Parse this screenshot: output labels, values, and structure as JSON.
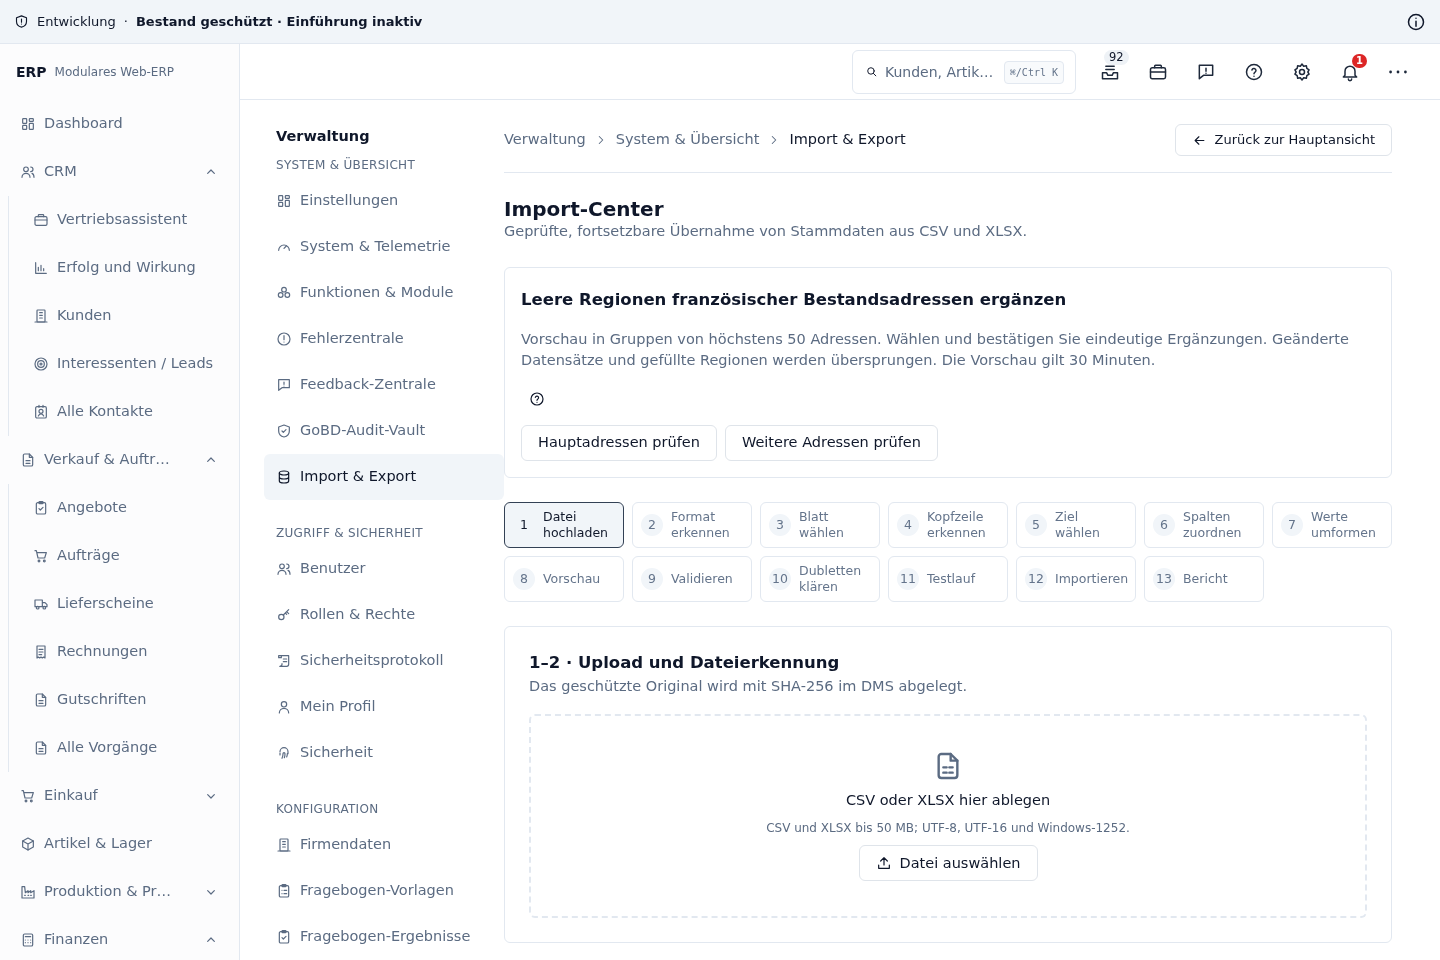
{
  "banner": {
    "environment": "Entwicklung",
    "separator": "·",
    "status": "Bestand geschützt · Einführung inaktiv"
  },
  "brand": {
    "name": "ERP",
    "subtitle": "Modulares Web-ERP"
  },
  "sidebar": {
    "items": [
      {
        "kind": "link",
        "label": "Dashboard"
      },
      {
        "kind": "group",
        "label": "CRM",
        "expanded": true,
        "children": [
          {
            "label": "Vertriebsassistent"
          },
          {
            "label": "Erfolg und Wirkung"
          },
          {
            "label": "Kunden"
          },
          {
            "label": "Interessenten / Leads"
          },
          {
            "label": "Alle Kontakte"
          }
        ]
      },
      {
        "kind": "group",
        "label": "Verkauf & Auftr…",
        "expanded": true,
        "children": [
          {
            "label": "Angebote"
          },
          {
            "label": "Aufträge"
          },
          {
            "label": "Lieferscheine"
          },
          {
            "label": "Rechnungen"
          },
          {
            "label": "Gutschriften"
          },
          {
            "label": "Alle Vorgänge"
          }
        ]
      },
      {
        "kind": "group",
        "label": "Einkauf",
        "expanded": false
      },
      {
        "kind": "link",
        "label": "Artikel & Lager"
      },
      {
        "kind": "group",
        "label": "Produktion & Pr…",
        "expanded": false
      },
      {
        "kind": "group",
        "label": "Finanzen",
        "expanded": true
      }
    ]
  },
  "header": {
    "search": {
      "placeholder": "Kunden, Artik…",
      "shortcut": "⌘/Ctrl K"
    },
    "inbox_count": "92",
    "notification_count": "1"
  },
  "subnav": {
    "title": "Verwaltung",
    "sections": [
      {
        "heading": "SYSTEM & ÜBERSICHT",
        "items": [
          {
            "label": "Einstellungen",
            "selected": false
          },
          {
            "label": "System & Telemetrie",
            "selected": false
          },
          {
            "label": "Funktionen & Module",
            "selected": false
          },
          {
            "label": "Fehlerzentrale",
            "selected": false
          },
          {
            "label": "Feedback-Zentrale",
            "selected": false
          },
          {
            "label": "GoBD-Audit-Vault",
            "selected": false
          },
          {
            "label": "Import & Export",
            "selected": true
          }
        ]
      },
      {
        "heading": "ZUGRIFF & SICHERHEIT",
        "items": [
          {
            "label": "Benutzer",
            "selected": false
          },
          {
            "label": "Rollen & Rechte",
            "selected": false
          },
          {
            "label": "Sicherheitsprotokoll",
            "selected": false
          },
          {
            "label": "Mein Profil",
            "selected": false
          },
          {
            "label": "Sicherheit",
            "selected": false
          }
        ]
      },
      {
        "heading": "KONFIGURATION",
        "items": [
          {
            "label": "Firmendaten",
            "selected": false
          },
          {
            "label": "Fragebogen-Vorlagen",
            "selected": false
          },
          {
            "label": "Fragebogen-Ergebnisse",
            "selected": false
          }
        ]
      }
    ]
  },
  "breadcrumb": [
    "Verwaltung",
    "System & Übersicht",
    "Import & Export"
  ],
  "back_button": "Zurück zur Hauptansicht",
  "page": {
    "title": "Import-Center",
    "subtitle": "Geprüfte, fortsetzbare Übernahme von Stammdaten aus CSV und XLSX."
  },
  "notice": {
    "title": "Leere Regionen französischer Bestandsadressen ergänzen",
    "text": "Vorschau in Gruppen von höchstens 50 Adressen. Wählen und bestätigen Sie eindeutige Ergänzungen. Geänderte Datensätze und gefüllte Regionen werden übersprungen. Die Vorschau gilt 30 Minuten.",
    "buttons": [
      "Hauptadressen prüfen",
      "Weitere Adressen prüfen"
    ]
  },
  "steps": [
    {
      "number": "1",
      "label": "Datei hochladen",
      "selected": true
    },
    {
      "number": "2",
      "label": "Format erkennen",
      "selected": false
    },
    {
      "number": "3",
      "label": "Blatt wählen",
      "selected": false
    },
    {
      "number": "4",
      "label": "Kopfzeile erkennen",
      "selected": false
    },
    {
      "number": "5",
      "label": "Ziel wählen",
      "selected": false
    },
    {
      "number": "6",
      "label": "Spalten zuordnen",
      "selected": false
    },
    {
      "number": "7",
      "label": "Werte umformen",
      "selected": false
    },
    {
      "number": "8",
      "label": "Vorschau",
      "selected": false
    },
    {
      "number": "9",
      "label": "Validieren",
      "selected": false
    },
    {
      "number": "10",
      "label": "Dubletten klären",
      "selected": false
    },
    {
      "number": "11",
      "label": "Testlauf",
      "selected": false
    },
    {
      "number": "12",
      "label": "Importieren",
      "selected": false
    },
    {
      "number": "13",
      "label": "Bericht",
      "selected": false
    }
  ],
  "upload": {
    "title": "1–2 · Upload und Dateierkennung",
    "subtitle": "Das geschützte Original wird mit SHA-256 im DMS abgelegt.",
    "drop_title": "CSV oder XLSX hier ablegen",
    "drop_hint": "CSV und XLSX bis 50 MB; UTF-8, UTF-16 und Windows-1252.",
    "button": "Datei auswählen"
  }
}
